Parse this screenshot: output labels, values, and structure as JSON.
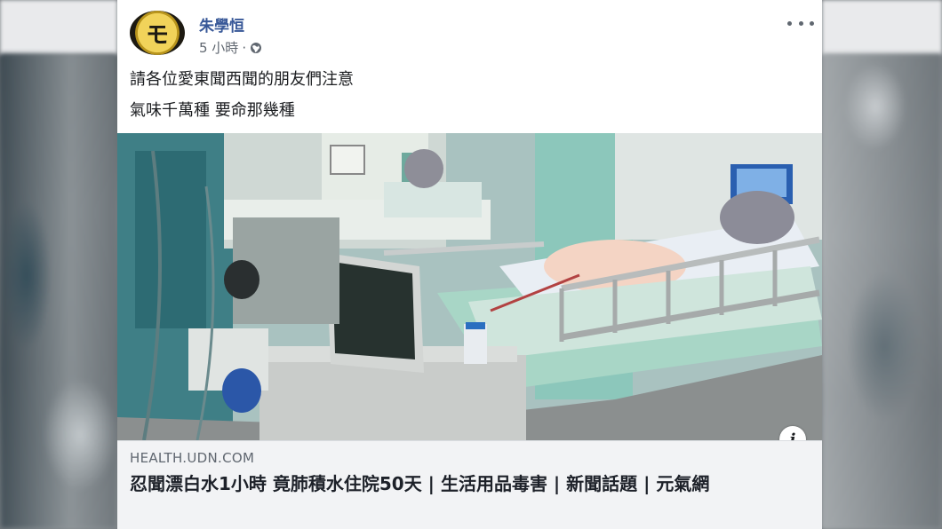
{
  "post": {
    "author_name": "朱學恒",
    "avatar_glyph": "モ",
    "timestamp": "5 小時",
    "separator": "·",
    "privacy_icon": "globe-icon",
    "more_icon": "more-horizontal-icon",
    "text_lines": [
      "請各位愛東聞西聞的朋友們注意",
      "氣味千萬種 要命那幾種"
    ]
  },
  "link_preview": {
    "image_description_icon": "info-icon",
    "info_label": "i",
    "domain": "HEALTH.UDN.COM",
    "title": "忍聞漂白水1小時 竟肺積水住院50天 | 生活用品毒害 | 新聞話題 | 元氣網"
  },
  "colors": {
    "author_link": "#385898",
    "secondary_text": "#606770",
    "link_background": "#f2f3f5"
  }
}
